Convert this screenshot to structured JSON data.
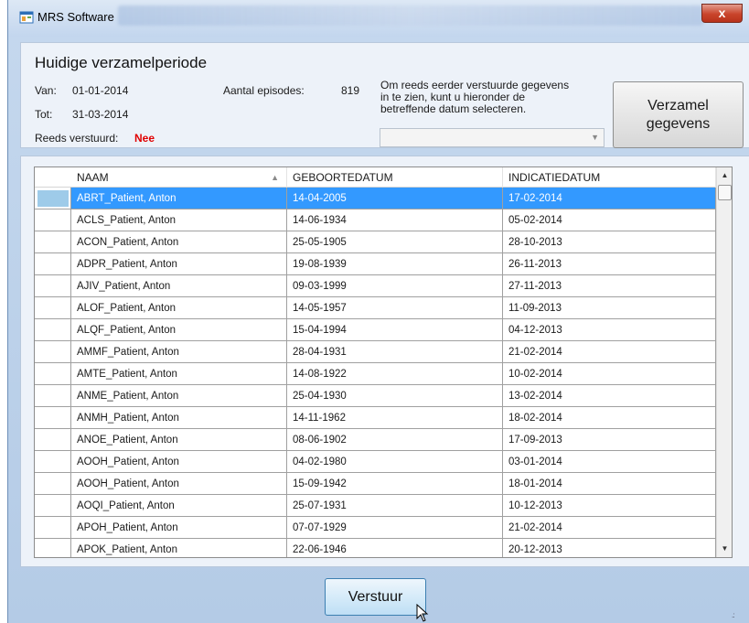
{
  "window": {
    "title": "MRS Software",
    "close_label": "x"
  },
  "period": {
    "heading": "Huidige verzamelperiode",
    "van_label": "Van:",
    "van_value": "01-01-2014",
    "tot_label": "Tot:",
    "tot_value": "31-03-2014",
    "episodes_label": "Aantal episodes:",
    "episodes_value": "819",
    "sent_label": "Reeds verstuurd:",
    "sent_value": "Nee",
    "info_line1": "Om reeds eerder verstuurde gegevens",
    "info_line2": "in te zien, kunt u hieronder de",
    "info_line3": "betreffende datum selecteren.",
    "combo_value": "",
    "collect_button_line1": "Verzamel",
    "collect_button_line2": "gegevens"
  },
  "grid": {
    "columns": [
      "NAAM",
      "GEBOORTEDATUM",
      "INDICATIEDATUM"
    ],
    "sorted_column": "NAAM",
    "sort_direction": "ascending",
    "selected_row": 0,
    "rows": [
      [
        "ABRT_Patient, Anton",
        "14-04-2005",
        "17-02-2014"
      ],
      [
        "ACLS_Patient, Anton",
        "14-06-1934",
        "05-02-2014"
      ],
      [
        "ACON_Patient, Anton",
        "25-05-1905",
        "28-10-2013"
      ],
      [
        "ADPR_Patient, Anton",
        "19-08-1939",
        "26-11-2013"
      ],
      [
        "AJIV_Patient, Anton",
        "09-03-1999",
        "27-11-2013"
      ],
      [
        "ALOF_Patient, Anton",
        "14-05-1957",
        "11-09-2013"
      ],
      [
        "ALQF_Patient, Anton",
        "15-04-1994",
        "04-12-2013"
      ],
      [
        "AMMF_Patient, Anton",
        "28-04-1931",
        "21-02-2014"
      ],
      [
        "AMTE_Patient, Anton",
        "14-08-1922",
        "10-02-2014"
      ],
      [
        "ANME_Patient, Anton",
        "25-04-1930",
        "13-02-2014"
      ],
      [
        "ANMH_Patient, Anton",
        "14-11-1962",
        "18-02-2014"
      ],
      [
        "ANOE_Patient, Anton",
        "08-06-1902",
        "17-09-2013"
      ],
      [
        "AOOH_Patient, Anton",
        "04-02-1980",
        "03-01-2014"
      ],
      [
        "AOOH_Patient, Anton",
        "15-09-1942",
        "18-01-2014"
      ],
      [
        "AOQI_Patient, Anton",
        "25-07-1931",
        "10-12-2013"
      ],
      [
        "APOH_Patient, Anton",
        "07-07-1929",
        "21-02-2014"
      ],
      [
        "APOK_Patient, Anton",
        "22-06-1946",
        "20-12-2013"
      ]
    ]
  },
  "footer": {
    "send_button": "Verstuur"
  },
  "colors": {
    "selection": "#3399ff",
    "sent_no": "#e00000",
    "window_bg": "#b4cbe6",
    "close": "#c9442b"
  },
  "icons": {
    "app": "app-window-icon",
    "close": "close-icon",
    "sort": "sort-ascending-icon"
  }
}
